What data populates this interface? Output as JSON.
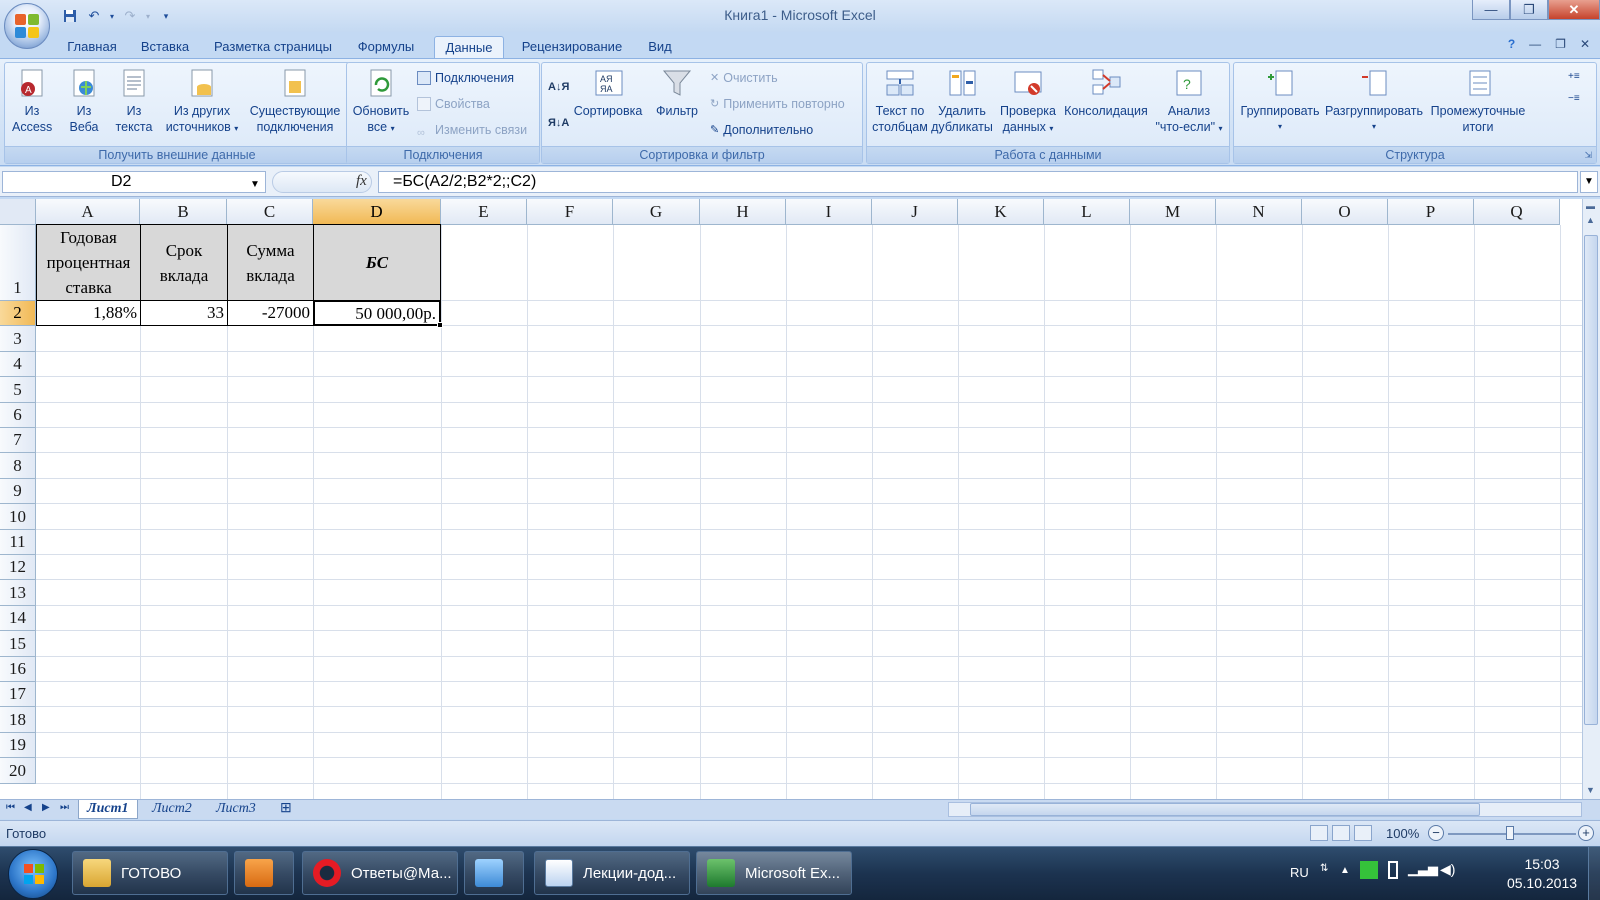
{
  "window": {
    "title": "Книга1 - Microsoft Excel"
  },
  "tabs": [
    "Главная",
    "Вставка",
    "Разметка страницы",
    "Формулы",
    "Данные",
    "Рецензирование",
    "Вид"
  ],
  "active_tab": "Данные",
  "ribbon": {
    "get_external": {
      "title": "Получить внешние данные",
      "access": "Из Access",
      "web": "Из Веба",
      "text": "Из текста",
      "other_l1": "Из других",
      "other_l2": "источников",
      "existing_l1": "Существующие",
      "existing_l2": "подключения"
    },
    "connections": {
      "title": "Подключения",
      "refresh_l1": "Обновить",
      "refresh_l2": "все",
      "connections": "Подключения",
      "properties": "Свойства",
      "edit_links": "Изменить связи"
    },
    "sort_filter": {
      "title": "Сортировка и фильтр",
      "sort": "Сортировка",
      "filter": "Фильтр",
      "clear": "Очистить",
      "reapply": "Применить повторно",
      "advanced": "Дополнительно"
    },
    "data_tools": {
      "title": "Работа с данными",
      "text_cols_l1": "Текст по",
      "text_cols_l2": "столбцам",
      "remove_dup_l1": "Удалить",
      "remove_dup_l2": "дубликаты",
      "validation_l1": "Проверка",
      "validation_l2": "данных",
      "consolidate": "Консолидация",
      "whatif_l1": "Анализ",
      "whatif_l2": "\"что-если\""
    },
    "outline": {
      "title": "Структура",
      "group": "Группировать",
      "ungroup": "Разгруппировать",
      "subtotal_l1": "Промежуточные",
      "subtotal_l2": "итоги"
    }
  },
  "formula_bar": {
    "name_box": "D2",
    "formula": "=БС(A2/2;B2*2;;C2)"
  },
  "columns": [
    "A",
    "B",
    "C",
    "D",
    "E",
    "F",
    "G",
    "H",
    "I",
    "J",
    "K",
    "L",
    "M",
    "N",
    "O",
    "P",
    "Q"
  ],
  "rows": [
    "1",
    "2",
    "3",
    "4",
    "5",
    "6",
    "7",
    "8",
    "9",
    "10",
    "11",
    "12",
    "13",
    "14",
    "15",
    "16",
    "17",
    "18",
    "19",
    "20"
  ],
  "cells": {
    "A1": [
      "Годовая",
      "процентная",
      "ставка"
    ],
    "B1": [
      "Срок",
      "вклада"
    ],
    "C1": [
      "Сумма",
      "вклада"
    ],
    "D1": "БС",
    "A2": "1,88%",
    "B2": "33",
    "C2": "-27000",
    "D2": "50 000,00р."
  },
  "sheets": [
    "Лист1",
    "Лист2",
    "Лист3"
  ],
  "active_sheet": "Лист1",
  "status": {
    "ready": "Готово",
    "zoom": "100%"
  },
  "taskbar": {
    "items": [
      {
        "label": "ГОТОВО",
        "icon": "folder-icon"
      },
      {
        "label": "",
        "icon": "media-player-icon"
      },
      {
        "label": "Ответы@Ма...",
        "icon": "opera-icon"
      },
      {
        "label": "",
        "icon": "photo-viewer-icon"
      },
      {
        "label": "Лекции-дод...",
        "icon": "word-doc-icon"
      },
      {
        "label": "Microsoft Ex...",
        "icon": "excel-icon"
      }
    ],
    "lang": "RU",
    "time": "15:03",
    "date": "05.10.2013"
  },
  "colors": {
    "accent": "#15428b",
    "selected_header": "#f1b955",
    "header_fill": "#d8d8d8"
  }
}
